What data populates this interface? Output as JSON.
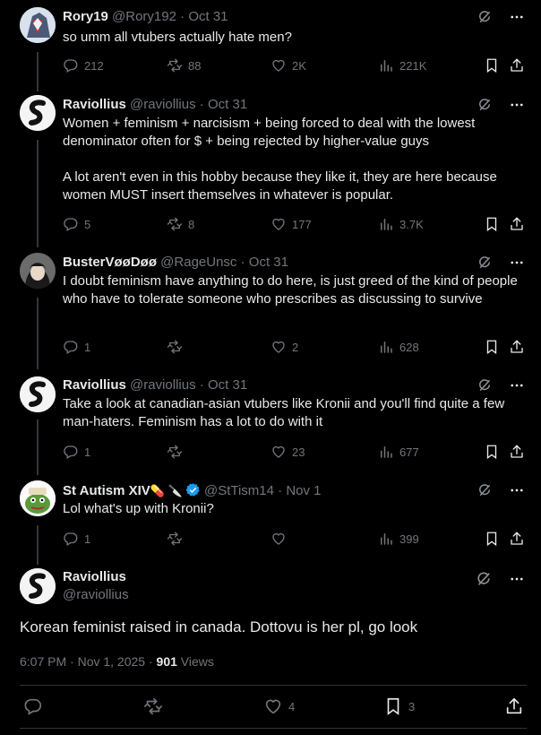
{
  "tweets": [
    {
      "name": "Rory19",
      "handle": "@Rory192",
      "date": "Oct 31",
      "text": "so umm all vtubers actually hate men?",
      "replies": "212",
      "reposts": "88",
      "likes": "2K",
      "views": "221K"
    },
    {
      "name": "Raviollius",
      "handle": "@raviollius",
      "date": "Oct 31",
      "text": "Women + feminism + narcisism + being forced to deal with the lowest denominator often for $ + being rejected by higher-value guys\n\nA lot aren't even in this hobby because they like it, they are here because women MUST insert themselves in whatever is popular.",
      "replies": "5",
      "reposts": "8",
      "likes": "177",
      "views": "3.7K"
    },
    {
      "name": "BusterVøøDøø",
      "handle": "@RageUnsc",
      "date": "Oct 31",
      "text": "I doubt feminism have anything to do here, is just greed of the kind of people who have to tolerate someone who prescribes as discussing to survive",
      "replies": "1",
      "reposts": "",
      "likes": "2",
      "views": "628"
    },
    {
      "name": "Raviollius",
      "handle": "@raviollius",
      "date": "Oct 31",
      "text": "Take a look at canadian-asian vtubers like Kronii and you'll find quite a few man-haters. Feminism has a lot to do with it",
      "replies": "1",
      "reposts": "",
      "likes": "23",
      "views": "677"
    },
    {
      "name": "St Autism XIV",
      "name_emoji": "💊 🔪",
      "handle": "@StTism14",
      "date": "Nov 1",
      "text": "Lol what's up with Kronii?",
      "replies": "1",
      "reposts": "",
      "likes": "",
      "views": "399"
    }
  ],
  "main": {
    "name": "Raviollius",
    "handle": "@raviollius",
    "text": "Korean feminist raised in canada. Dottovu is her pl, go look",
    "time": "6:07 PM · Nov 1, 2025 · ",
    "views_count": "901",
    "views_label": " Views",
    "replies": "",
    "reposts": "",
    "likes": "4",
    "bookmarks": "3"
  },
  "dot": " · ",
  "colors": {
    "bg": "#000000",
    "text": "#e7e9ea",
    "muted": "#71767b",
    "verified": "#1d9bf0"
  },
  "icons": [
    "reply-icon",
    "repost-icon",
    "like-icon",
    "views-icon",
    "bookmark-icon",
    "share-icon",
    "grok-icon",
    "more-icon",
    "verified-badge-icon"
  ]
}
